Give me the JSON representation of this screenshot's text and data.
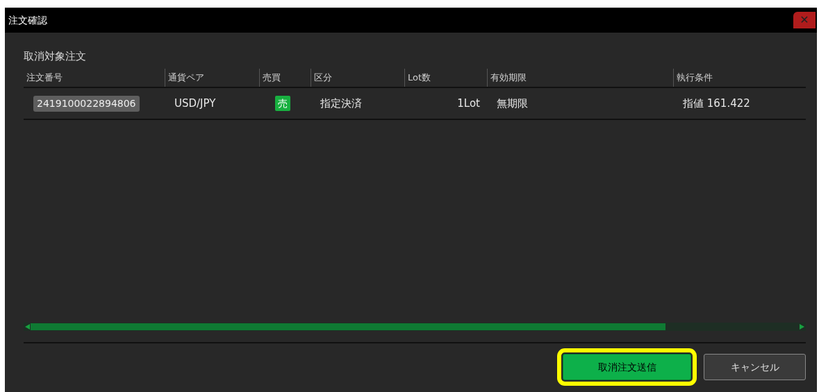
{
  "window": {
    "title": "注文確認",
    "close": "✕"
  },
  "section_title": "取消対象注文",
  "table": {
    "columns": [
      {
        "label": "注文番号"
      },
      {
        "label": "通貨ペア"
      },
      {
        "label": "売買"
      },
      {
        "label": "区分"
      },
      {
        "label": "Lot数"
      },
      {
        "label": "有効期限"
      },
      {
        "label": "執行条件"
      }
    ],
    "rows": [
      {
        "cells": [
          {
            "kind": "id",
            "text": "2419100022894806"
          },
          {
            "kind": "text",
            "text": "USD/JPY"
          },
          {
            "kind": "side",
            "text": "売"
          },
          {
            "kind": "text",
            "text": "指定決済"
          },
          {
            "kind": "text",
            "text": "1Lot"
          },
          {
            "kind": "text",
            "text": "無期限"
          },
          {
            "kind": "text",
            "text": "指値 161.422"
          }
        ]
      }
    ]
  },
  "buttons": [
    {
      "label": "取消注文送信",
      "kind": "primary",
      "highlighted": true
    },
    {
      "label": "キャンセル",
      "kind": "secondary",
      "highlighted": false
    }
  ]
}
